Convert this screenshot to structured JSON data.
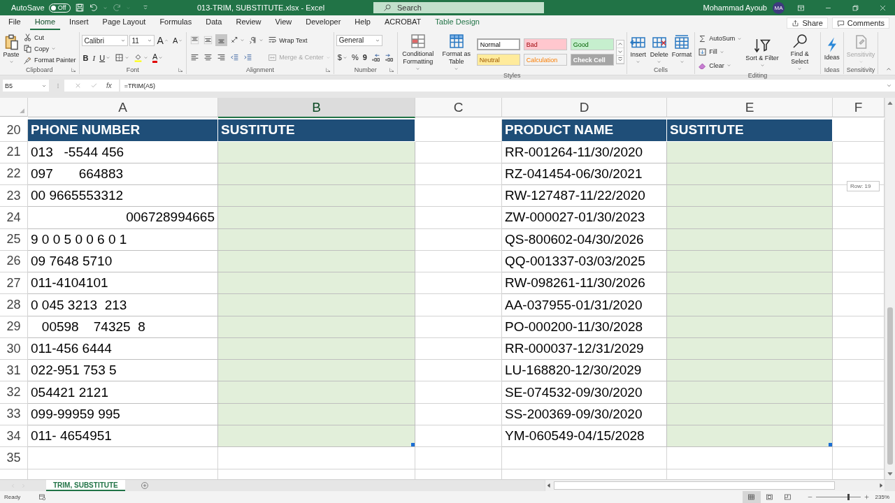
{
  "title_bar": {
    "autosave_label": "AutoSave",
    "autosave": {
      "label": "Off",
      "on": false
    },
    "title": "013-TRIM, SUBSTITUTE.xlsx  -  Excel",
    "search": {
      "placeholder": "Search"
    },
    "user": "Mohammad Ayoub",
    "avatar": "MA"
  },
  "menu_tabs": [
    {
      "label": "File",
      "selected": false,
      "kind": "plain"
    },
    {
      "label": "Home",
      "selected": true,
      "kind": "plain"
    },
    {
      "label": "Insert",
      "selected": false,
      "kind": "plain"
    },
    {
      "label": "Page Layout",
      "selected": false,
      "kind": "plain"
    },
    {
      "label": "Formulas",
      "selected": false,
      "kind": "plain"
    },
    {
      "label": "Data",
      "selected": false,
      "kind": "plain"
    },
    {
      "label": "Review",
      "selected": false,
      "kind": "plain"
    },
    {
      "label": "View",
      "selected": false,
      "kind": "plain"
    },
    {
      "label": "Developer",
      "selected": false,
      "kind": "plain"
    },
    {
      "label": "Help",
      "selected": false,
      "kind": "plain"
    },
    {
      "label": "ACROBAT",
      "selected": false,
      "kind": "plain"
    },
    {
      "label": "Table Design",
      "selected": false,
      "kind": "contextual"
    }
  ],
  "share": "Share",
  "comments": "Comments",
  "ribbon": {
    "groups": [
      {
        "label": "Clipboard",
        "launcher": true,
        "columns": [
          [
            {
              "kind": "large",
              "label": "Paste",
              "dropdown": true,
              "disabled": false
            }
          ],
          [
            {
              "kind": "small",
              "label": "Cut",
              "dropdown": false,
              "disabled": false
            },
            {
              "kind": "small",
              "label": "Copy",
              "dropdown": true,
              "disabled": false
            },
            {
              "kind": "small",
              "label": "Format Painter",
              "dropdown": false,
              "disabled": false
            }
          ]
        ]
      },
      {
        "label": "Font",
        "launcher": true,
        "columns": [
          [
            {
              "kind": "row",
              "items": [
                {
                  "kind": "field",
                  "value": "Calibri"
                },
                {
                  "kind": "field",
                  "value": "11"
                },
                {
                  "kind": "glyph",
                  "text": "A",
                  "dropdown": false
                },
                {
                  "kind": "glyph",
                  "text": "A",
                  "dropdown": false
                }
              ]
            },
            {
              "kind": "row",
              "items": [
                {
                  "kind": "glyph",
                  "text": "B",
                  "dropdown": false
                },
                {
                  "kind": "glyph",
                  "text": "I",
                  "dropdown": false
                },
                {
                  "kind": "glyph",
                  "text": "U",
                  "dropdown": true
                },
                {
                  "kind": "tool",
                  "dropdown": true,
                  "selected": false
                },
                {
                  "kind": "tool",
                  "dropdown": true,
                  "selected": false
                },
                {
                  "kind": "glyph",
                  "text": "A",
                  "dropdown": true
                }
              ]
            }
          ]
        ]
      },
      {
        "label": "Alignment",
        "launcher": true,
        "columns": [
          [
            {
              "kind": "row",
              "items": [
                {
                  "kind": "tool",
                  "dropdown": false,
                  "selected": false
                },
                {
                  "kind": "tool",
                  "dropdown": false,
                  "selected": false
                },
                {
                  "kind": "tool",
                  "dropdown": false,
                  "selected": true
                },
                {
                  "kind": "tool",
                  "dropdown": true,
                  "selected": false
                },
                {
                  "kind": "tool",
                  "dropdown": true,
                  "selected": false
                }
              ]
            },
            {
              "kind": "row",
              "items": [
                {
                  "kind": "tool",
                  "dropdown": false,
                  "selected": false
                },
                {
                  "kind": "tool",
                  "dropdown": false,
                  "selected": false
                },
                {
                  "kind": "tool",
                  "dropdown": false,
                  "selected": false
                },
                {
                  "kind": "tool",
                  "dropdown": false,
                  "selected": false
                },
                {
                  "kind": "tool",
                  "dropdown": false,
                  "selected": false
                }
              ]
            }
          ],
          [
            {
              "kind": "small",
              "label": "Wrap Text",
              "dropdown": false,
              "disabled": false
            },
            {
              "kind": "small",
              "label": "Merge & Center",
              "dropdown": true,
              "disabled": true
            }
          ]
        ]
      },
      {
        "label": "Number",
        "launcher": true,
        "columns": [
          [
            {
              "kind": "field",
              "value": "General"
            },
            {
              "kind": "row",
              "items": [
                {
                  "kind": "glyph",
                  "text": "$",
                  "dropdown": true
                },
                {
                  "kind": "glyph",
                  "text": "%",
                  "dropdown": false
                },
                {
                  "kind": "glyph",
                  "text": "9",
                  "dropdown": false
                },
                {
                  "kind": "tool",
                  "dropdown": false,
                  "selected": false
                },
                {
                  "kind": "tool",
                  "dropdown": false,
                  "selected": false
                }
              ]
            }
          ]
        ]
      },
      {
        "label": "Styles",
        "launcher": false,
        "columns": [
          [
            {
              "kind": "large",
              "label": "Conditional Formatting",
              "dropdown": true,
              "disabled": false
            }
          ],
          [
            {
              "kind": "large",
              "label": "Format as Table",
              "dropdown": true,
              "disabled": false
            }
          ],
          [
            {
              "kind": "gallery",
              "styles": [
                {
                  "label": "Normal",
                  "color": "#ffffff",
                  "selected": true
                },
                {
                  "label": "Bad",
                  "color": "#ffc7ce",
                  "selected": false
                },
                {
                  "label": "Good",
                  "color": "#c6efce",
                  "selected": false
                },
                {
                  "label": "Neutral",
                  "color": "#ffeb9c",
                  "selected": false
                },
                {
                  "label": "Calculation",
                  "color": "#f2f2f2",
                  "selected": false
                },
                {
                  "label": "Check Cell",
                  "color": "#a5a5a5",
                  "selected": false
                }
              ]
            }
          ]
        ]
      },
      {
        "label": "Cells",
        "launcher": false,
        "columns": [
          [
            {
              "kind": "large",
              "label": "Insert",
              "dropdown": true,
              "disabled": false
            }
          ],
          [
            {
              "kind": "large",
              "label": "Delete",
              "dropdown": true,
              "disabled": false
            }
          ],
          [
            {
              "kind": "large",
              "label": "Format",
              "dropdown": true,
              "disabled": false
            }
          ]
        ]
      },
      {
        "label": "Editing",
        "launcher": false,
        "columns": [
          [
            {
              "kind": "small",
              "label": "AutoSum",
              "dropdown": true,
              "disabled": false
            },
            {
              "kind": "small",
              "label": "Fill",
              "dropdown": true,
              "disabled": false
            },
            {
              "kind": "small",
              "label": "Clear",
              "dropdown": true,
              "disabled": false
            }
          ],
          [
            {
              "kind": "large",
              "label": "Sort & Filter",
              "dropdown": true,
              "disabled": false
            }
          ],
          [
            {
              "kind": "large",
              "label": "Find & Select",
              "dropdown": true,
              "disabled": false
            }
          ]
        ]
      },
      {
        "label": "Ideas",
        "launcher": false,
        "columns": [
          [
            {
              "kind": "large",
              "label": "Ideas",
              "dropdown": false,
              "disabled": false
            }
          ]
        ]
      },
      {
        "label": "Sensitivity",
        "launcher": false,
        "columns": [
          [
            {
              "kind": "large",
              "label": "Sensitivity",
              "dropdown": true,
              "disabled": true
            }
          ]
        ]
      }
    ]
  },
  "formula_bar": {
    "name_box": "B5",
    "fx": "fx",
    "formula": "=TRIM(A5)"
  },
  "sheet": {
    "columns": [
      {
        "label": "A",
        "selected": false
      },
      {
        "label": "B",
        "selected": true
      },
      {
        "label": "C",
        "selected": false
      },
      {
        "label": "D",
        "selected": false
      },
      {
        "label": "E",
        "selected": false
      },
      {
        "label": "F",
        "selected": false
      }
    ],
    "rows": [
      {
        "number": "20",
        "cells": [
          {
            "kind": "header",
            "text": "PHONE NUMBER"
          },
          {
            "kind": "header",
            "text": "SUSTITUTE"
          },
          {
            "kind": "empty"
          },
          {
            "kind": "header",
            "text": "PRODUCT NAME"
          },
          {
            "kind": "header",
            "text": "SUSTITUTE"
          },
          {
            "kind": "empty"
          }
        ]
      },
      {
        "number": "21",
        "cells": [
          {
            "kind": "text",
            "text": "013   -5544 456"
          },
          {
            "kind": "fill"
          },
          {
            "kind": "empty"
          },
          {
            "kind": "text",
            "text": "RR-001264-11/30/2020"
          },
          {
            "kind": "fill"
          },
          {
            "kind": "empty"
          }
        ]
      },
      {
        "number": "22",
        "cells": [
          {
            "kind": "text",
            "text": "097       664883"
          },
          {
            "kind": "fill"
          },
          {
            "kind": "empty"
          },
          {
            "kind": "text",
            "text": "RZ-041454-06/30/2021"
          },
          {
            "kind": "fill"
          },
          {
            "kind": "empty"
          }
        ]
      },
      {
        "number": "23",
        "cells": [
          {
            "kind": "text",
            "text": "00 9665553312"
          },
          {
            "kind": "fill"
          },
          {
            "kind": "empty"
          },
          {
            "kind": "text",
            "text": "RW-127487-11/22/2020"
          },
          {
            "kind": "fill"
          },
          {
            "kind": "empty"
          }
        ]
      },
      {
        "number": "24",
        "cells": [
          {
            "kind": "number",
            "text": "006728994665"
          },
          {
            "kind": "fill"
          },
          {
            "kind": "empty"
          },
          {
            "kind": "text",
            "text": "ZW-000027-01/30/2023"
          },
          {
            "kind": "fill"
          },
          {
            "kind": "empty"
          }
        ]
      },
      {
        "number": "25",
        "cells": [
          {
            "kind": "text",
            "text": "9 0 0 5 0 0 6 0 1"
          },
          {
            "kind": "fill"
          },
          {
            "kind": "empty"
          },
          {
            "kind": "text",
            "text": "QS-800602-04/30/2026"
          },
          {
            "kind": "fill"
          },
          {
            "kind": "empty"
          }
        ]
      },
      {
        "number": "26",
        "cells": [
          {
            "kind": "text",
            "text": "09 7648 5710"
          },
          {
            "kind": "fill"
          },
          {
            "kind": "empty"
          },
          {
            "kind": "text",
            "text": "QQ-001337-03/03/2025"
          },
          {
            "kind": "fill"
          },
          {
            "kind": "empty"
          }
        ]
      },
      {
        "number": "27",
        "cells": [
          {
            "kind": "text",
            "text": "011-4104101"
          },
          {
            "kind": "fill"
          },
          {
            "kind": "empty"
          },
          {
            "kind": "text",
            "text": "RW-098261-11/30/2026"
          },
          {
            "kind": "fill"
          },
          {
            "kind": "empty"
          }
        ]
      },
      {
        "number": "28",
        "cells": [
          {
            "kind": "text",
            "text": "0 045 3213  213"
          },
          {
            "kind": "fill"
          },
          {
            "kind": "empty"
          },
          {
            "kind": "text",
            "text": "AA-037955-01/31/2020"
          },
          {
            "kind": "fill"
          },
          {
            "kind": "empty"
          }
        ]
      },
      {
        "number": "29",
        "cells": [
          {
            "kind": "text",
            "text": "   00598    74325  8"
          },
          {
            "kind": "fill"
          },
          {
            "kind": "empty"
          },
          {
            "kind": "text",
            "text": "PO-000200-11/30/2028"
          },
          {
            "kind": "fill"
          },
          {
            "kind": "empty"
          }
        ]
      },
      {
        "number": "30",
        "cells": [
          {
            "kind": "text",
            "text": "011-456 6444"
          },
          {
            "kind": "fill"
          },
          {
            "kind": "empty"
          },
          {
            "kind": "text",
            "text": "RR-000037-12/31/2029"
          },
          {
            "kind": "fill"
          },
          {
            "kind": "empty"
          }
        ]
      },
      {
        "number": "31",
        "cells": [
          {
            "kind": "text",
            "text": "022-951 753 5"
          },
          {
            "kind": "fill"
          },
          {
            "kind": "empty"
          },
          {
            "kind": "text",
            "text": "LU-168820-12/30/2029"
          },
          {
            "kind": "fill"
          },
          {
            "kind": "empty"
          }
        ]
      },
      {
        "number": "32",
        "cells": [
          {
            "kind": "text",
            "text": "054421 2121"
          },
          {
            "kind": "fill"
          },
          {
            "kind": "empty"
          },
          {
            "kind": "text",
            "text": "SE-074532-09/30/2020"
          },
          {
            "kind": "fill"
          },
          {
            "kind": "empty"
          }
        ]
      },
      {
        "number": "33",
        "cells": [
          {
            "kind": "text",
            "text": "099-99959 995"
          },
          {
            "kind": "fill"
          },
          {
            "kind": "empty"
          },
          {
            "kind": "text",
            "text": "SS-200369-09/30/2020"
          },
          {
            "kind": "fill"
          },
          {
            "kind": "empty"
          }
        ]
      },
      {
        "number": "34",
        "cells": [
          {
            "kind": "text",
            "text": "011- 4654951"
          },
          {
            "kind": "fill"
          },
          {
            "kind": "empty"
          },
          {
            "kind": "text",
            "text": "YM-060549-04/15/2028"
          },
          {
            "kind": "fill"
          },
          {
            "kind": "empty"
          }
        ]
      },
      {
        "number": "35",
        "cells": [
          {
            "kind": "empty"
          },
          {
            "kind": "empty"
          },
          {
            "kind": "empty"
          },
          {
            "kind": "empty"
          },
          {
            "kind": "empty"
          },
          {
            "kind": "empty"
          }
        ]
      }
    ],
    "tooltip": "Row: 19"
  },
  "sheet_tabs": [
    {
      "label": "TRIM, SUBSTITUTE",
      "selected": true
    }
  ],
  "status_bar": {
    "status": "Ready",
    "views": [
      {
        "kind": "normal",
        "selected": true
      },
      {
        "kind": "page_layout",
        "selected": false
      },
      {
        "kind": "page_break",
        "selected": false
      }
    ],
    "zoom": {
      "level": 0.72,
      "reading": "235%"
    }
  }
}
